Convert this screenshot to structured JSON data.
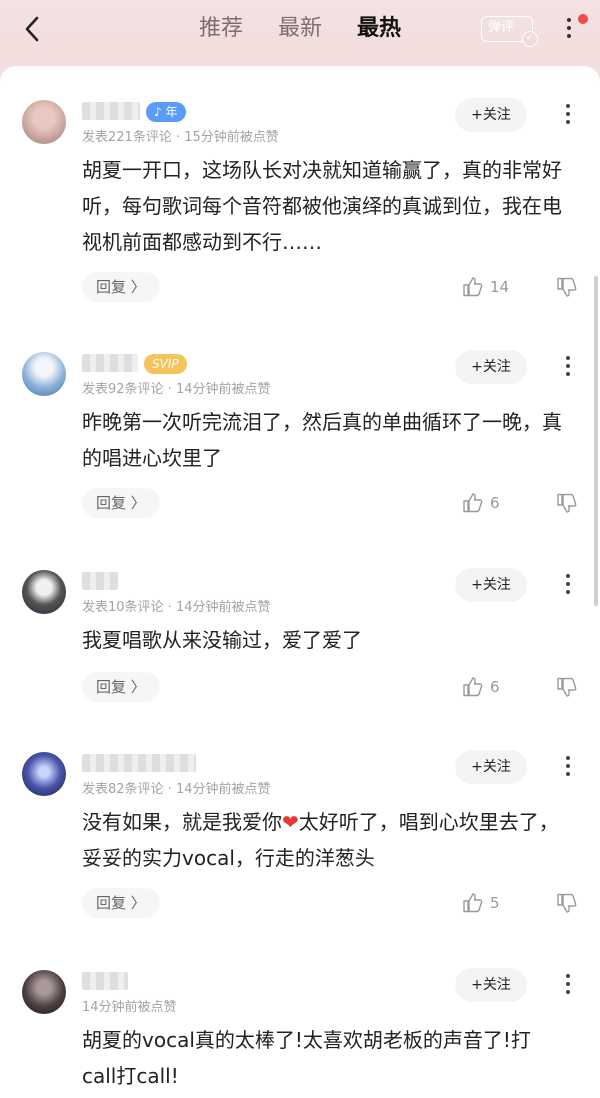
{
  "header": {
    "tabs": [
      {
        "label": "推荐",
        "active": false
      },
      {
        "label": "最新",
        "active": false
      },
      {
        "label": "最热",
        "active": true
      }
    ],
    "danmu_label": "弹评"
  },
  "ui": {
    "follow_label": "+关注",
    "reply_label": "回复 〉"
  },
  "comments": [
    {
      "badge": "年",
      "meta": "发表221条评论 · 15分钟前被点赞",
      "text": "胡夏一开口，这场队长对决就知道输赢了，真的非常好听，每句歌词每个音符都被他演绎的真诚到位，我在电视机前面都感动到不行……",
      "likes": "14"
    },
    {
      "badge": "SVIP",
      "meta": "发表92条评论 · 14分钟前被点赞",
      "text": "昨晚第一次听完流泪了，然后真的单曲循环了一晚，真的唱进心坎里了",
      "likes": "6"
    },
    {
      "badge": "",
      "meta": "发表10条评论 · 14分钟前被点赞",
      "text": "我夏唱歌从来没输过，爱了爱了",
      "likes": "6"
    },
    {
      "badge": "",
      "meta": "发表82条评论 · 14分钟前被点赞",
      "text_before": "没有如果，就是我爱你",
      "text_after": "太好听了，唱到心坎里去了，妥妥的实力vocal，行走的洋葱头",
      "likes": "5"
    },
    {
      "badge": "",
      "meta": "14分钟前被点赞",
      "text": "胡夏的vocal真的太棒了!太喜欢胡老板的声音了!打call打call!",
      "likes": ""
    }
  ],
  "colors": {
    "header_bg": "#f2dcdc",
    "badge_year": "#5a9cf8",
    "badge_svip": "#f4c35a",
    "heart": "#e53935"
  }
}
